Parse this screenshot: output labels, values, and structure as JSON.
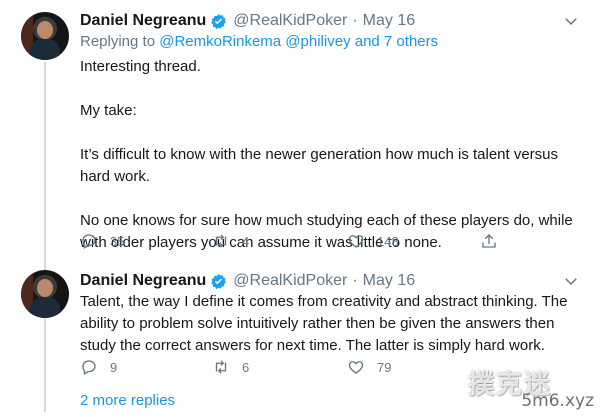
{
  "tweets": [
    {
      "author_name": "Daniel Negreanu",
      "handle": "@RealKidPoker",
      "separator": "·",
      "date": "May 16",
      "reply_prefix": "Replying to",
      "reply_targets": "@RemkoRinkema @philivey and 7 others",
      "paragraphs": [
        "Interesting thread.",
        "My take:",
        "It’s difficult to know with the newer generation how much is talent versus hard work.",
        "No one knows for sure how much studying each of these players do, while with older players you can assume it was little to none."
      ],
      "replies": "35",
      "retweets": "4",
      "likes": "148"
    },
    {
      "author_name": "Daniel Negreanu",
      "handle": "@RealKidPoker",
      "separator": "·",
      "date": "May 16",
      "paragraphs": [
        "Talent, the way I define it comes from creativity and abstract thinking. The ability to problem solve intuitively rather then be given the answers then study the correct answers for next time. The latter is simply hard work."
      ],
      "replies": "9",
      "retweets": "6",
      "likes": "79"
    }
  ],
  "more_replies": "2 more replies",
  "watermark_cn": "撲克迷",
  "watermark_site": "5m6.xyz",
  "colors": {
    "link": "#1b95e0",
    "muted": "#657786",
    "verified": "#1da1f2"
  }
}
